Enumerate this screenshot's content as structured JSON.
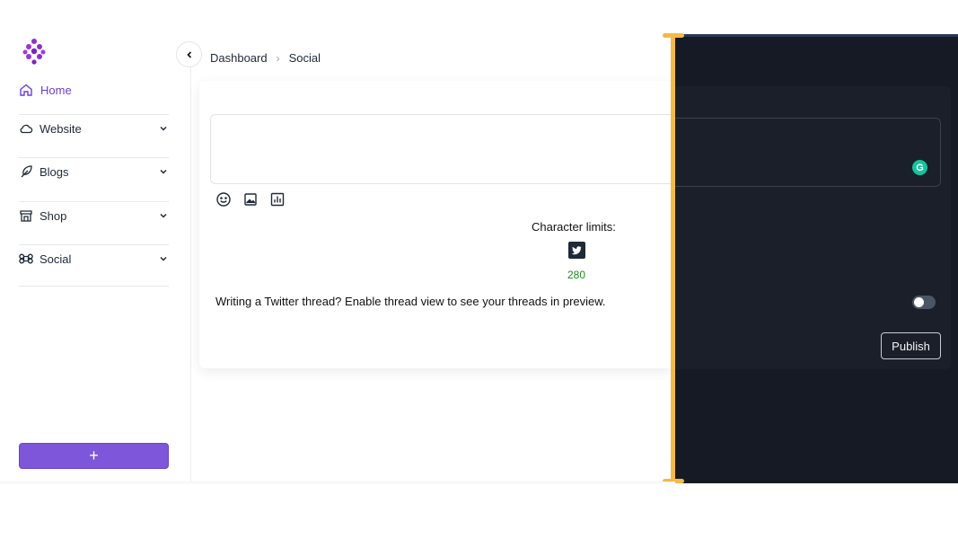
{
  "sidebar": {
    "home_label": "Home",
    "items": [
      {
        "label": "Website",
        "icon": "cloud-icon"
      },
      {
        "label": "Blogs",
        "icon": "feather-icon"
      },
      {
        "label": "Shop",
        "icon": "store-icon"
      },
      {
        "label": "Social",
        "icon": "command-icon"
      }
    ],
    "add_label": "+"
  },
  "breadcrumb": {
    "root": "Dashboard",
    "separator": "›",
    "current": "Social"
  },
  "composer": {
    "char_limits_label": "Character limits:",
    "twitter_limit": "280",
    "thread_prompt": "Writing a Twitter thread? Enable thread view to see your threads in preview.",
    "grammarly_label": "G",
    "thread_view_enabled": false,
    "publish_label": "Publish"
  },
  "colors": {
    "accent": "#7e56d9",
    "home_active": "#6b3fd4",
    "count_green": "#1f8a1f",
    "dark_bg": "#161a24",
    "handle": "#f5b947"
  }
}
